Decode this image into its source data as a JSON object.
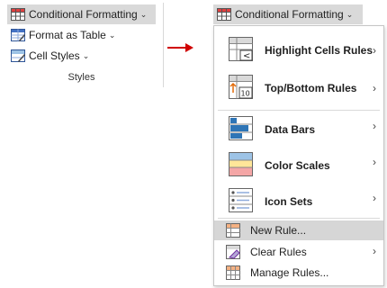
{
  "ribbon": {
    "conditional_formatting": {
      "label": "Conditional Formatting",
      "icon": "conditional-formatting-icon"
    },
    "format_as_table": {
      "label": "Format as Table",
      "icon": "format-as-table-icon"
    },
    "cell_styles": {
      "label": "Cell Styles",
      "icon": "cell-styles-icon"
    },
    "group_label": "Styles"
  },
  "dropdown_button": {
    "label": "Conditional Formatting"
  },
  "menu": {
    "highlight": {
      "label": "Highlight Cells Rules",
      "icon": "highlight-cells-rules-icon"
    },
    "topbottom": {
      "label": "Top/Bottom Rules",
      "icon": "top-bottom-rules-icon"
    },
    "databars": {
      "label": "Data Bars",
      "icon": "data-bars-icon"
    },
    "colorscales": {
      "label": "Color Scales",
      "icon": "color-scales-icon"
    },
    "iconsets": {
      "label": "Icon Sets",
      "icon": "icon-sets-icon"
    },
    "newrule": {
      "label": "New Rule...",
      "icon": "new-rule-icon"
    },
    "clearrules": {
      "label": "Clear Rules",
      "icon": "clear-rules-icon"
    },
    "managerules": {
      "label": "Manage Rules...",
      "icon": "manage-rules-icon"
    },
    "top10_badge": "10"
  },
  "colors": {
    "arrow": "#d00000",
    "hover": "#d6d6d6"
  }
}
